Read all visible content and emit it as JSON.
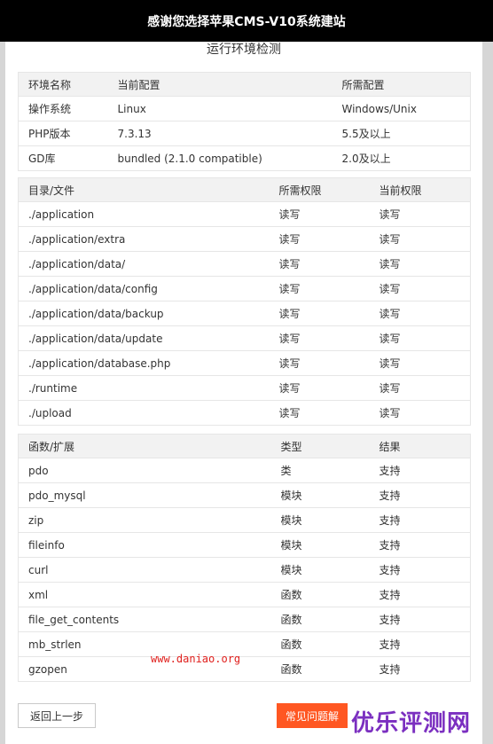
{
  "header": {
    "title": "感谢您选择苹果CMS-V10系统建站"
  },
  "subtitle": "运行环境检测",
  "env_table": {
    "headers": [
      "环境名称",
      "当前配置",
      "所需配置"
    ],
    "rows": [
      [
        "操作系统",
        "Linux",
        "Windows/Unix"
      ],
      [
        "PHP版本",
        "7.3.13",
        "5.5及以上"
      ],
      [
        "GD库",
        "bundled (2.1.0 compatible)",
        "2.0及以上"
      ]
    ]
  },
  "dir_table": {
    "headers": [
      "目录/文件",
      "所需权限",
      "当前权限"
    ],
    "rows": [
      [
        "./application",
        "读写",
        "读写"
      ],
      [
        "./application/extra",
        "读写",
        "读写"
      ],
      [
        "./application/data/",
        "读写",
        "读写"
      ],
      [
        "./application/data/config",
        "读写",
        "读写"
      ],
      [
        "./application/data/backup",
        "读写",
        "读写"
      ],
      [
        "./application/data/update",
        "读写",
        "读写"
      ],
      [
        "./application/database.php",
        "读写",
        "读写"
      ],
      [
        "./runtime",
        "读写",
        "读写"
      ],
      [
        "./upload",
        "读写",
        "读写"
      ]
    ]
  },
  "func_table": {
    "headers": [
      "函数/扩展",
      "类型",
      "结果"
    ],
    "rows": [
      [
        "pdo",
        "类",
        "支持"
      ],
      [
        "pdo_mysql",
        "模块",
        "支持"
      ],
      [
        "zip",
        "模块",
        "支持"
      ],
      [
        "fileinfo",
        "模块",
        "支持"
      ],
      [
        "curl",
        "模块",
        "支持"
      ],
      [
        "xml",
        "函数",
        "支持"
      ],
      [
        "file_get_contents",
        "函数",
        "支持"
      ],
      [
        "mb_strlen",
        "函数",
        "支持"
      ],
      [
        "gzopen",
        "函数",
        "支持"
      ]
    ]
  },
  "buttons": {
    "back": "返回上一步",
    "faq": "常见问题解"
  },
  "watermark": "www.daniao.org",
  "brand": "优乐评测网",
  "colors": {
    "header_bg": "#000000",
    "faq_button": "#ff5722",
    "watermark": "#e0201d",
    "brand": "#7b2fc0"
  }
}
